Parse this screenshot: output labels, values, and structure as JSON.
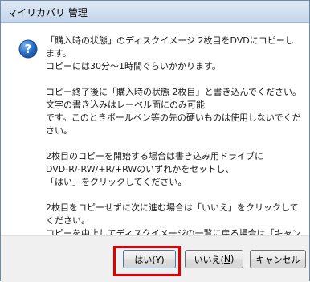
{
  "window": {
    "title": "マイリカバリ 管理"
  },
  "dialog": {
    "icon": "question-icon",
    "paragraphs": [
      "「購入時の状態」のディスクイメージ 2枚目をDVDにコピーします。\nコピーには30分～1時間ぐらいかかります。",
      "コピー終了後に「購入時の状態 2枚目」と書き込んでください。文字の書き込みはレーベル面にのみ可能\nです。このときボールペン等の先の硬いものは使用しないでください。",
      "2枚目のコピーを開始する場合は書き込み用ドライブに\nDVD-R/-RW/+R/+RWのいずれかをセットし、\n「はい」をクリックしてください。",
      "2枚目をコピーせずに次に進む場合は「いいえ」をクリックしてください。\nコピーを中止してディスクイメージの一覧に戻る場合は「キャンセル」をクリックしてください。"
    ]
  },
  "buttons": {
    "yes_label": "はい(Y)",
    "no_label_prefix": "いいえ(",
    "no_label_key": "N",
    "no_label_suffix": ")",
    "cancel_label": "キャンセル"
  },
  "colors": {
    "highlight": "#e00000",
    "icon_blue": "#1f5fb3"
  }
}
